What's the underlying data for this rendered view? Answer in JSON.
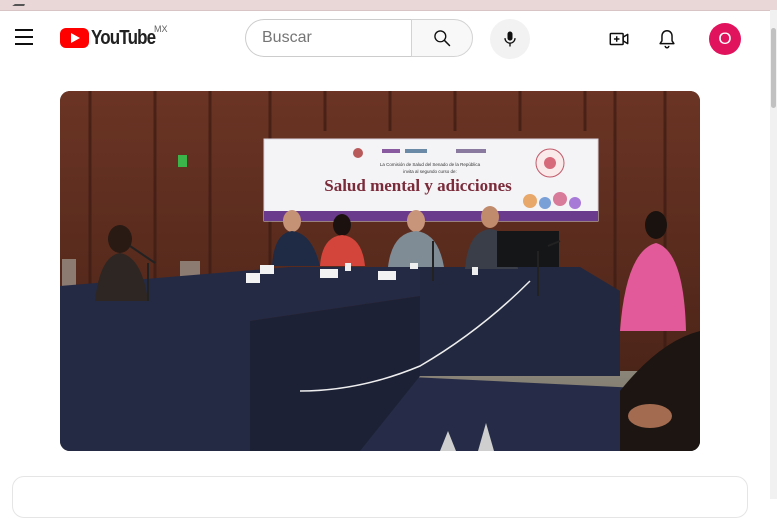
{
  "masthead": {
    "logo_text": "YouTube",
    "country_code": "MX",
    "search_placeholder": "Buscar",
    "avatar_letter": "O"
  },
  "video": {
    "banner_small_line1": "La Comisión de Salud del Senado de la República",
    "banner_small_line2": "invita al segundo curso de:",
    "banner_title": "Salud mental y adicciones"
  },
  "colors": {
    "youtube_red": "#ff0000",
    "avatar_bg": "#e0135c",
    "banner_title_color": "#7a2b3a"
  },
  "icons": {
    "menu": "hamburger-menu-icon",
    "search": "search-icon",
    "mic": "microphone-icon",
    "create": "create-video-icon",
    "notifications": "bell-icon"
  }
}
